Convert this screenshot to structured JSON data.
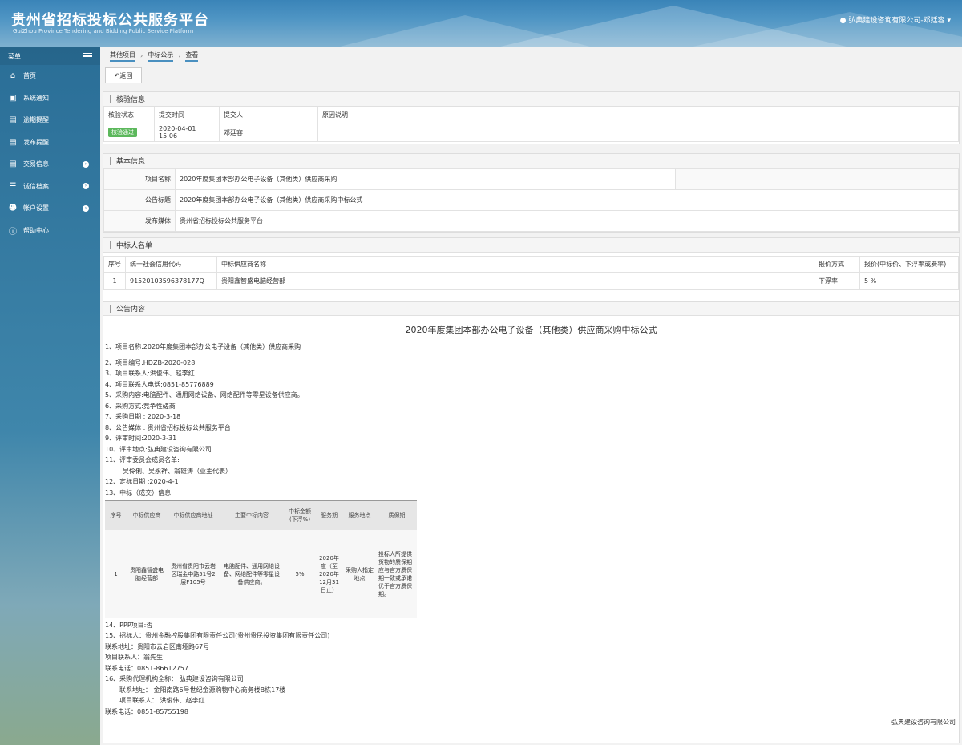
{
  "header": {
    "title": "贵州省招标投标公共服务平台",
    "subtitle": "GuiZhou Province Tendering and Bidding Public Service Platform",
    "user": "弘典建设咨询有限公司-邓廷容"
  },
  "sidebar": {
    "heading": "菜单",
    "items": [
      {
        "label": "首页",
        "icon": "home-icon"
      },
      {
        "label": "系统通知",
        "icon": "monitor-icon"
      },
      {
        "label": "逾期提醒",
        "icon": "list-icon"
      },
      {
        "label": "发布提醒",
        "icon": "list-icon"
      },
      {
        "label": "交易信息",
        "icon": "list-icon"
      },
      {
        "label": "诚信档案",
        "icon": "doc-icon"
      },
      {
        "label": "帐户设置",
        "icon": "user-icon"
      },
      {
        "label": "帮助中心",
        "icon": "help-icon"
      }
    ]
  },
  "breadcrumb": [
    "其他项目",
    "中标公示",
    "查看"
  ],
  "back_label": "返回",
  "verify": {
    "title": "核验信息",
    "headers": [
      "核验状态",
      "提交时间",
      "提交人",
      "原因说明"
    ],
    "status": "核验通过",
    "time": "2020-04-01 15:06",
    "person": "邓廷容",
    "reason": ""
  },
  "basic": {
    "title": "基本信息",
    "rows": [
      {
        "label": "项目名称",
        "value": "2020年度集团本部办公电子设备（其他类）供应商采购"
      },
      {
        "label": "公告标题",
        "value": "2020年度集团本部办公电子设备（其他类）供应商采购中标公式"
      },
      {
        "label": "发布媒体",
        "value": "贵州省招标投标公共服务平台"
      }
    ]
  },
  "winners": {
    "title": "中标人名单",
    "headers": [
      "序号",
      "统一社会信用代码",
      "中标供应商名称",
      "报价方式",
      "报价(中标价、下浮率或费率)"
    ],
    "row": [
      "1",
      "91520103596378177Q",
      "贵阳鑫智盛电脑经营部",
      "下浮率",
      "5 %"
    ]
  },
  "notice": {
    "title": "公告内容",
    "doc_title": "2020年度集团本部办公电子设备（其他类）供应商采购中标公式",
    "lines_a": [
      "1、项目名称:2020年度集团本部办公电子设备（其他类）供应商采购",
      "2、项目编号:HDZB-2020-028",
      "3、项目联系人:洪俊伟、赵李红",
      "4、项目联系人电话:0851-85776889",
      "5、采购内容:电脑配件、通用网络设备、网络配件等零星设备供应商。",
      "6、采购方式:竞争性磋商",
      "7、采购日期 : 2020-3-18",
      "8、公告媒体 : 贵州省招标投标公共服务平台",
      "9、评审时间:2020-3-31",
      "10、评审地点:弘典建设咨询有限公司",
      "11、评审委员会成员名单:",
      "吴伶俐、吴永祥、翁雄涛（业主代表）",
      "12、定标日期 :2020-4-1",
      "13、中标（成交）信息:"
    ],
    "award_headers": [
      "序号",
      "中标供应商",
      "中标供应商地址",
      "主要中标内容",
      "中标金额(下浮%)",
      "服务期",
      "服务地点",
      "质保期"
    ],
    "award_row": [
      "1",
      "贵阳鑫智盛电脑经营部",
      "贵州省贵阳市云岩区瑞金中路51号2层F105号",
      "电脑配件、通用网络设备、网络配件等零星设备供应商。",
      "5%",
      "2020年度（至2020年12月31日止）",
      "采购人指定地点",
      "投标人所提供货物的质保期应与官方质保期一致或承诺优于官方质保期。"
    ],
    "lines_b": [
      "14、PPP项目:否",
      "15、招标人：贵州金融控股集团有限责任公司(贵州贵民投资集团有限责任公司)",
      "联系地址：贵阳市云岩区南垭路67号",
      "项目联系人：翁先生",
      "联系电话：0851-86612757",
      "16、采购代理机构全称：  弘典建设咨询有限公司",
      "联系地址：  金阳南路6号世纪金源购物中心商务楼B栋17楼",
      "项目联系人：  洪俊伟、赵李红",
      "联系电话：0851-85755198"
    ],
    "signature": "弘典建设咨询有限公司"
  }
}
